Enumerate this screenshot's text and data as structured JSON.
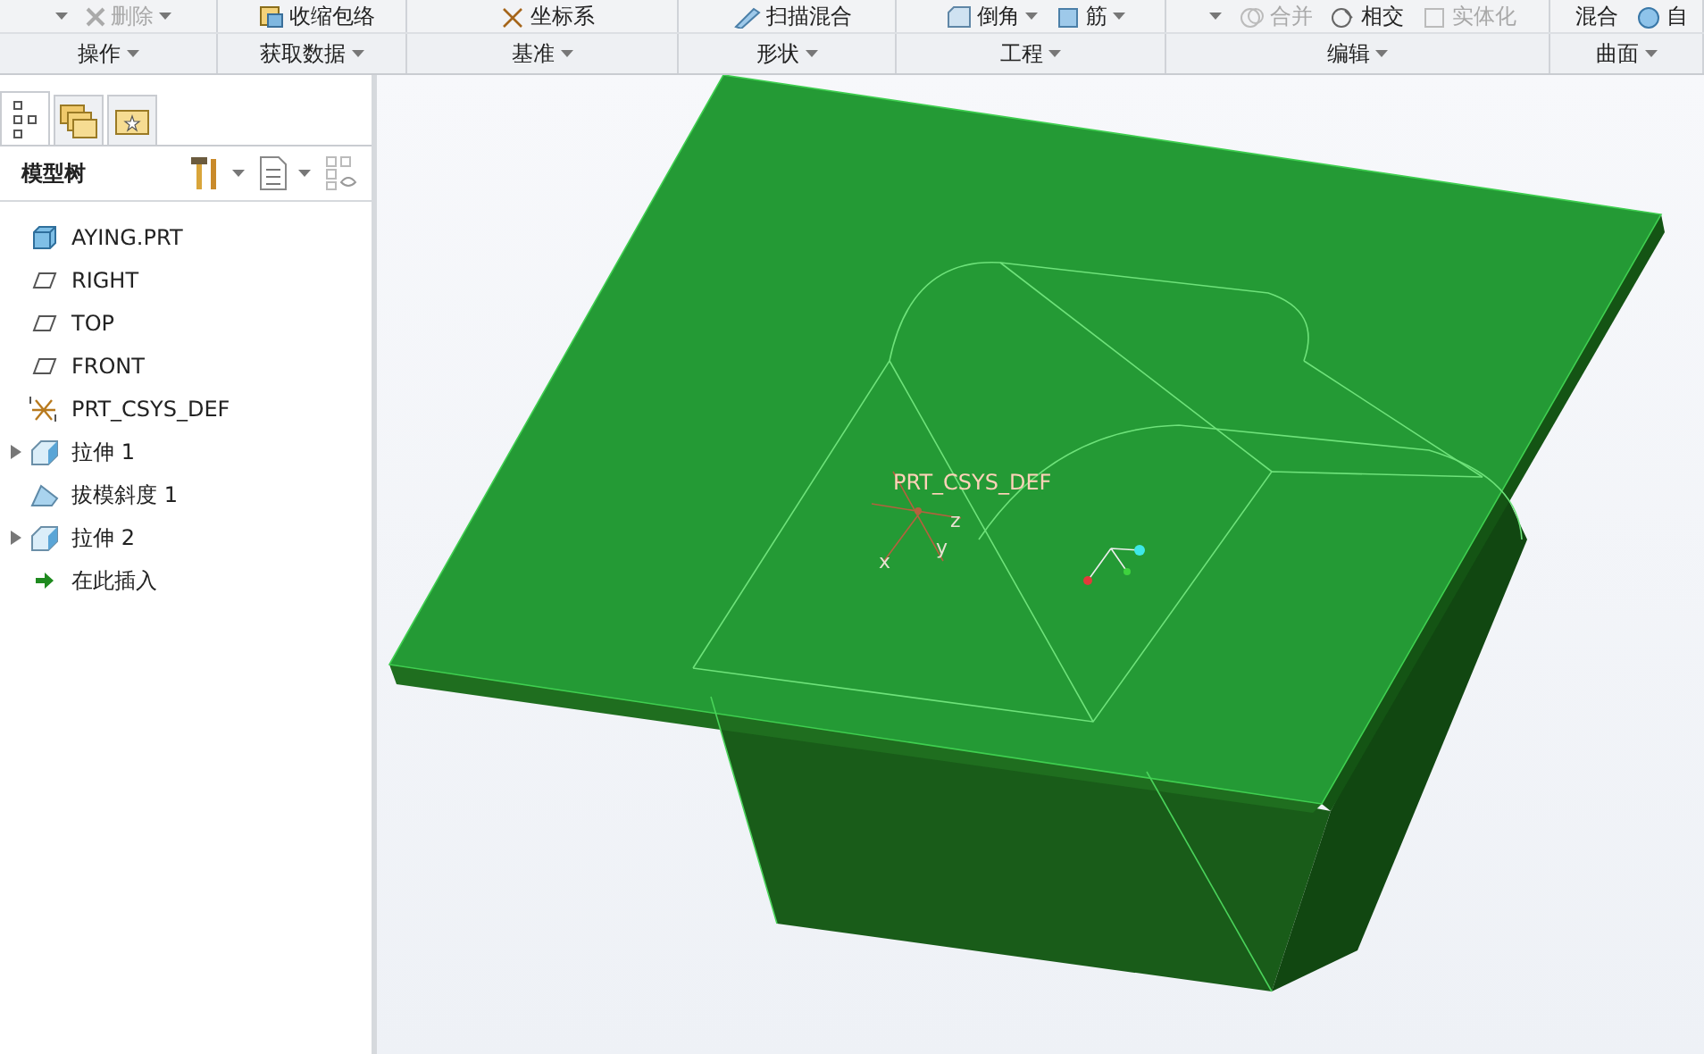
{
  "ribbon": {
    "groups": [
      {
        "label": "操作",
        "commands": [
          {
            "kind": "caret",
            "disabled": false,
            "menu": true
          },
          {
            "label": "删除",
            "kind": "delete",
            "disabled": true,
            "menu": true
          }
        ]
      },
      {
        "label": "获取数据",
        "commands": [
          {
            "label": "收缩包络",
            "kind": "shrinkwrap",
            "disabled": false,
            "menu": false
          }
        ]
      },
      {
        "label": "基准",
        "commands": [
          {
            "label": "坐标系",
            "kind": "csys",
            "disabled": false,
            "menu": false
          }
        ]
      },
      {
        "label": "形状",
        "commands": [
          {
            "label": "扫描混合",
            "kind": "sweep",
            "disabled": false,
            "menu": false
          }
        ]
      },
      {
        "label": "工程",
        "commands": [
          {
            "label": "倒角",
            "kind": "chamfer",
            "disabled": false,
            "menu": true
          },
          {
            "label": "筋",
            "kind": "rib",
            "disabled": false,
            "menu": true
          }
        ]
      },
      {
        "label": "编辑",
        "commands": [
          {
            "kind": "caret",
            "disabled": false,
            "menu": true
          },
          {
            "label": "合并",
            "kind": "merge",
            "disabled": true,
            "menu": false
          },
          {
            "label": "相交",
            "kind": "intersect",
            "disabled": false,
            "menu": false
          },
          {
            "label": "实体化",
            "kind": "solidify",
            "disabled": true,
            "menu": false
          }
        ]
      },
      {
        "label": "曲面",
        "commands": [
          {
            "label": "混合",
            "kind": "text",
            "disabled": false,
            "menu": false
          },
          {
            "label": "自",
            "kind": "freestyle",
            "disabled": false,
            "menu": false
          }
        ]
      }
    ]
  },
  "panel": {
    "tabs": [
      {
        "kind": "tree",
        "selected": true
      },
      {
        "kind": "folders",
        "selected": false
      },
      {
        "kind": "favorites",
        "selected": false
      }
    ],
    "title": "模型树",
    "tree": [
      {
        "label": "AYING.PRT",
        "kind": "part",
        "expandable": false
      },
      {
        "label": "RIGHT",
        "kind": "plane",
        "expandable": false
      },
      {
        "label": "TOP",
        "kind": "plane",
        "expandable": false
      },
      {
        "label": "FRONT",
        "kind": "plane",
        "expandable": false
      },
      {
        "label": "PRT_CSYS_DEF",
        "kind": "csys",
        "expandable": false
      },
      {
        "label": "拉伸 1",
        "kind": "extrude",
        "expandable": true
      },
      {
        "label": "拔模斜度 1",
        "kind": "draft",
        "expandable": false
      },
      {
        "label": "拉伸 2",
        "kind": "extrude",
        "expandable": true
      },
      {
        "label": "在此插入",
        "kind": "insert",
        "expandable": false
      }
    ]
  },
  "viewport": {
    "csys_label": "PRT_CSYS_DEF",
    "axes": [
      "z",
      "y",
      "x"
    ]
  }
}
